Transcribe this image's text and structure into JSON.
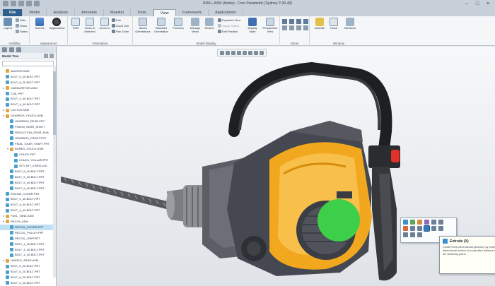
{
  "window": {
    "title": "DRILL.ASM (Active) - Creo Parametric (Sydney P-30-40)"
  },
  "tabs": [
    {
      "label": "File"
    },
    {
      "label": "Model"
    },
    {
      "label": "Analysis"
    },
    {
      "label": "Annotate"
    },
    {
      "label": "Manikin"
    },
    {
      "label": "Tools"
    },
    {
      "label": "View"
    },
    {
      "label": "Framework"
    },
    {
      "label": "Applications"
    }
  ],
  "ribbon": {
    "visibility": {
      "label": "Visibility",
      "layers": "Layers",
      "hide": "Hide",
      "show": "Show",
      "status": "Status"
    },
    "appearance": {
      "label": "Appearance",
      "scenes": "Scenes",
      "appearance": "Appearance"
    },
    "orientation": {
      "label": "Orientation",
      "refit": "Refit",
      "zoom_selected": "Zoom to Selected",
      "zoom_in": "Zoom In",
      "pan": "Pan",
      "zoom_out": "Zoom Out",
      "pan_zoom": "Pan Zoom"
    },
    "model_display": {
      "label": "Model Display",
      "saved_orientations": "Saved Orientations",
      "standard_orientation": "Standard Orientation",
      "previous": "Previous",
      "manage_views": "Manage Views",
      "section": "Section",
      "exploded_view": "Exploded View",
      "toggle_status": "Toggle Status",
      "edit_position": "Edit Position",
      "display_style": "Display Style",
      "perspective_view": "Perspective View"
    },
    "show": {
      "label": "Show"
    },
    "window": {
      "label": "Window",
      "activate": "Activate",
      "close": "Close",
      "windows": "Windows"
    }
  },
  "model_tree": {
    "title": "Model Tree",
    "rows": [
      {
        "label": "MASTER.ASM",
        "type": "asm",
        "level": 0,
        "exp": ""
      },
      {
        "label": "BOLT_5_20-BOLT-PRT",
        "type": "prt",
        "level": 0,
        "exp": ""
      },
      {
        "label": "BOLT_5_20-BOLT-PRT",
        "type": "prt",
        "level": 0,
        "exp": ""
      },
      {
        "label": "CARBURETOR.ASM",
        "type": "asm",
        "level": 0,
        "exp": "▸"
      },
      {
        "label": "COIL.PRT",
        "type": "prt",
        "level": 0,
        "exp": ""
      },
      {
        "label": "BOLT_4_40-BOLT-PRT",
        "type": "prt",
        "level": 0,
        "exp": ""
      },
      {
        "label": "BOLT_4_40-BOLT-PRT",
        "type": "prt",
        "level": 0,
        "exp": ""
      },
      {
        "label": "CLUTCH.ASM",
        "type": "asm",
        "level": 0,
        "exp": "▸"
      },
      {
        "label": "GEARBOX_CHUCK.ASM",
        "type": "asm",
        "level": 0,
        "exp": "▾"
      },
      {
        "label": "GEARBOX_REAR.PRT",
        "type": "prt",
        "level": 1,
        "exp": ""
      },
      {
        "label": "PINION_GEAR_SHAFT",
        "type": "prt",
        "level": 1,
        "exp": ""
      },
      {
        "label": "REDUCTION_GEAR_SHA",
        "type": "prt",
        "level": 1,
        "exp": ""
      },
      {
        "label": "GEARBOX_FRONT.PRT",
        "type": "prt",
        "level": 1,
        "exp": ""
      },
      {
        "label": "FINAL_GEAR_SHAFT.PRT",
        "type": "prt",
        "level": 1,
        "exp": ""
      },
      {
        "label": "BORED_CHUCK.ASM",
        "type": "asm",
        "level": 1,
        "exp": "▾"
      },
      {
        "label": "CHUCK.PRT",
        "type": "prt",
        "level": 2,
        "exp": ""
      },
      {
        "label": "CHUCK_COLLAR.PRT",
        "type": "prt",
        "level": 2,
        "exp": ""
      },
      {
        "label": "STD_BIT_0.3604-100...",
        "type": "prt",
        "level": 2,
        "exp": ""
      },
      {
        "label": "BOLT_5_40-BOLT-PRT",
        "type": "prt",
        "level": 1,
        "exp": ""
      },
      {
        "label": "BOLT_5_40-BOLT-PRT",
        "type": "prt",
        "level": 1,
        "exp": ""
      },
      {
        "label": "BOLT_5_40-BOLT-PRT",
        "type": "prt",
        "level": 1,
        "exp": ""
      },
      {
        "label": "BOLT_5_40-BOLT-PRT",
        "type": "prt",
        "level": 1,
        "exp": ""
      },
      {
        "label": "ENGINE_COVER.PRT",
        "type": "prt",
        "level": 0,
        "exp": ""
      },
      {
        "label": "BOLT_4_40-BOLT-PRT",
        "type": "prt",
        "level": 0,
        "exp": ""
      },
      {
        "label": "BOLT_4_40-BOLT-PRT",
        "type": "prt",
        "level": 0,
        "exp": ""
      },
      {
        "label": "BOLT_4_40-BOLT-PRT",
        "type": "prt",
        "level": 0,
        "exp": ""
      },
      {
        "label": "FUEL_TANK.ASM",
        "type": "asm",
        "level": 0,
        "exp": "▸"
      },
      {
        "label": "RECOIL.ASM",
        "type": "asm",
        "level": 0,
        "exp": "▾"
      },
      {
        "label": "RECOIL_COVER.PRT",
        "type": "prt",
        "level": 1,
        "exp": "",
        "selected": true
      },
      {
        "label": "RECOIL_PULLEY.PRT",
        "type": "prt",
        "level": 1,
        "exp": ""
      },
      {
        "label": "RECOIL_GRIP.PRT",
        "type": "prt",
        "level": 1,
        "exp": ""
      },
      {
        "label": "BOLT_4_40-BOLT-PRT",
        "type": "prt",
        "level": 1,
        "exp": ""
      },
      {
        "label": "BOLT_4_40-BOLT-PRT",
        "type": "prt",
        "level": 1,
        "exp": ""
      },
      {
        "label": "BOLT_4_40-BOLT-PRT",
        "type": "prt",
        "level": 1,
        "exp": ""
      },
      {
        "label": "HANDLE_REAR.ASM",
        "type": "asm",
        "level": 0,
        "exp": "▸"
      },
      {
        "label": "BOLT_6_20-BOLT-PRT",
        "type": "prt",
        "level": 0,
        "exp": ""
      },
      {
        "label": "BOLT_6_20-BOLT-PRT",
        "type": "prt",
        "level": 0,
        "exp": ""
      },
      {
        "label": "BOLT_6_20-BOLT-PRT",
        "type": "prt",
        "level": 0,
        "exp": ""
      },
      {
        "label": "BOLT_6_20-BOLT-PRT",
        "type": "prt",
        "level": 0,
        "exp": ""
      },
      {
        "label": "BOLT_6_20-BOLT-PRT",
        "type": "prt",
        "level": 0,
        "exp": ""
      }
    ]
  },
  "tooltip": {
    "title": "Extrude (X)",
    "body": "Create three-dimensional geometry by projecting a two-dimensional section at a specified distance normal to the sketching plane."
  },
  "colors": {
    "accent": "#2f5f8c",
    "engine": "#f2a81e",
    "selection_green": "#3ecf4a",
    "switch_red": "#e0312b"
  }
}
